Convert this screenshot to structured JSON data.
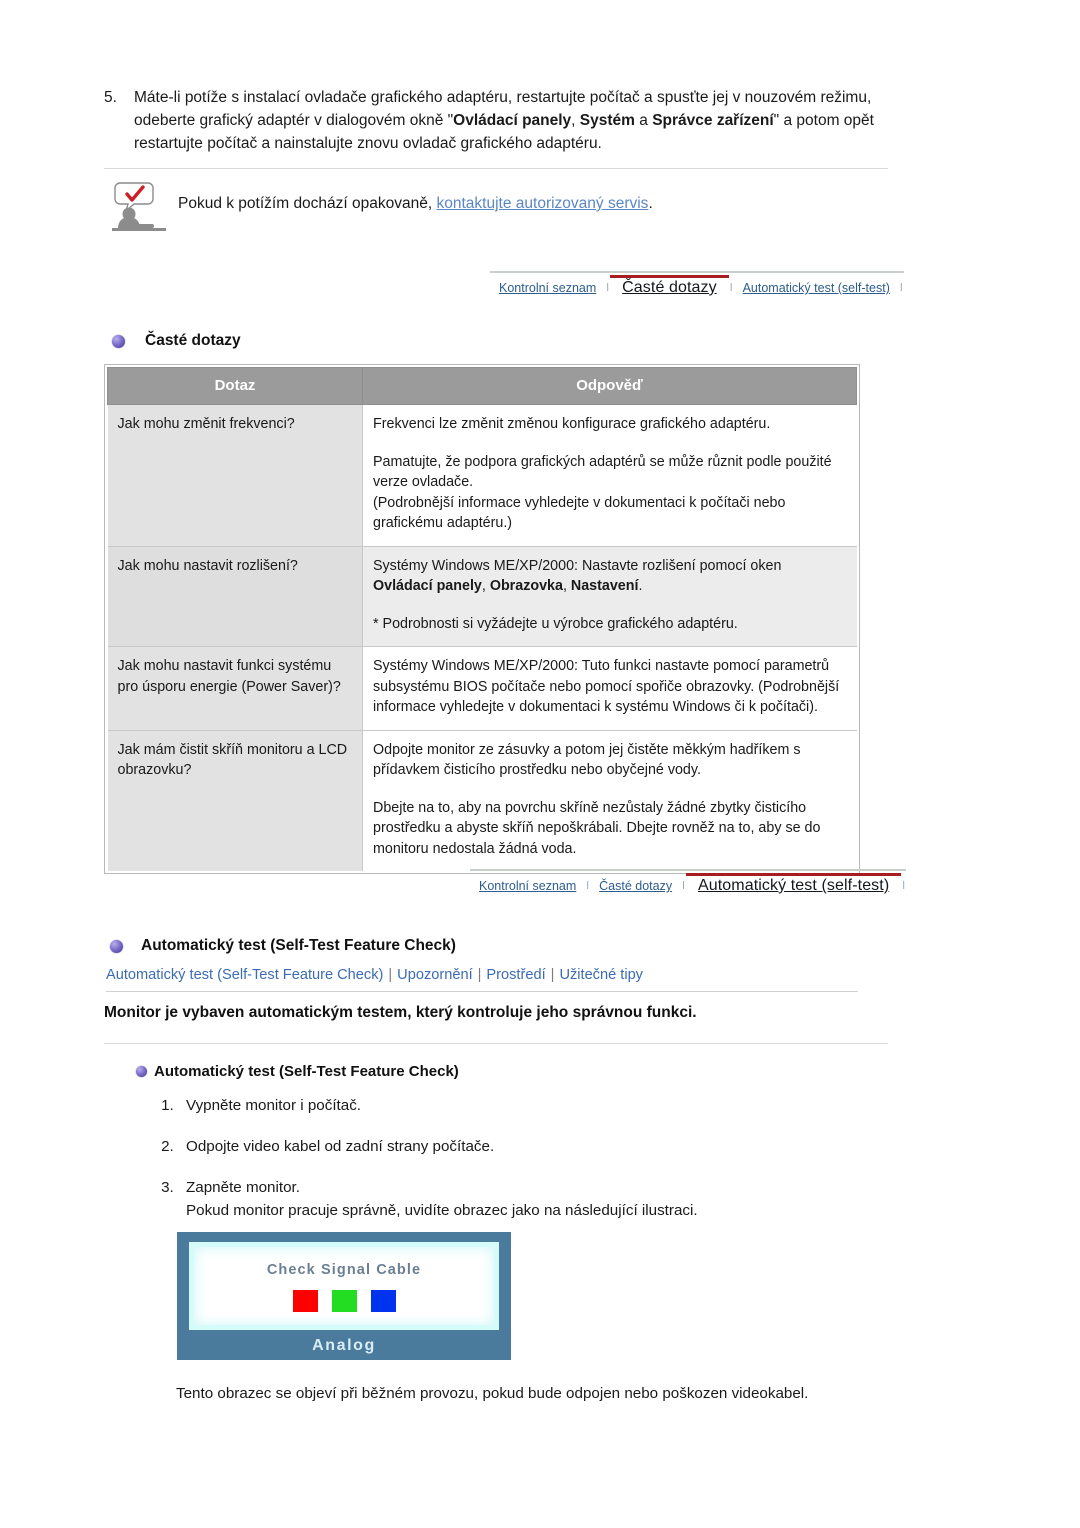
{
  "step5": {
    "number": "5.",
    "parts": [
      {
        "t": "Máte-li potíže s instalací ovladače grafického adaptéru, restartujte počítač a spusťte jej v nouzovém režimu, odeberte grafický adaptér v dialogovém okně \"",
        "b": false
      },
      {
        "t": "Ovládací panely",
        "b": true
      },
      {
        "t": ", ",
        "b": false
      },
      {
        "t": "Systém",
        "b": true
      },
      {
        "t": " a ",
        "b": false
      },
      {
        "t": "Správce zařízení",
        "b": true
      },
      {
        "t": "\" a potom opět restartujte počítač a nainstalujte znovu ovladač grafického adaptéru.",
        "b": false
      }
    ]
  },
  "tip": {
    "icon": "person-with-check-bubble-icon",
    "text_before": "Pokud k potížím dochází opakovaně, ",
    "link_text": "kontaktujte autorizovaný servis",
    "text_after": "."
  },
  "tabnav_1": {
    "tabs": [
      {
        "label": "Kontrolní seznam",
        "active": false
      },
      {
        "label": "Časté dotazy",
        "active": true
      },
      {
        "label": "Automatický test (self-test)",
        "active": false
      }
    ],
    "accent_color": "#a81d22",
    "link_color": "#2d5d8e"
  },
  "tabnav_2": {
    "tabs": [
      {
        "label": "Kontrolní seznam",
        "active": false
      },
      {
        "label": "Časté dotazy",
        "active": false
      },
      {
        "label": "Automatický test (self-test)",
        "active": true
      }
    ],
    "accent_color": "#a81d22",
    "link_color": "#2d5d8e"
  },
  "faq": {
    "heading": "Časté dotazy",
    "bullet_icon": "purple-ball-bullet-icon",
    "columns": [
      "Dotaz",
      "Odpověď"
    ],
    "header_bg": "#9b9b9b",
    "rows": [
      {
        "shade": false,
        "question": "Jak mohu změnit frekvenci?",
        "answer_blocks": [
          [
            {
              "t": "Frekvenci lze změnit změnou konfigurace grafického adaptéru.",
              "b": false
            }
          ],
          [
            {
              "t": "Pamatujte, že podpora grafických adaptérů se může různit podle použité verze ovladače.",
              "b": false
            }
          ],
          [
            {
              "t": "(Podrobnější informace vyhledejte v dokumentaci k počítači nebo grafickému adaptéru.)",
              "b": false
            }
          ]
        ],
        "tight_after": [
          1
        ]
      },
      {
        "shade": true,
        "question": "Jak mohu nastavit rozlišení?",
        "answer_blocks": [
          [
            {
              "t": "Systémy Windows ME/XP/2000: Nastavte rozlišení pomocí oken ",
              "b": false
            },
            {
              "t": "Ovládací panely",
              "b": true
            },
            {
              "t": ", ",
              "b": false
            },
            {
              "t": "Obrazovka",
              "b": true
            },
            {
              "t": ", ",
              "b": false
            },
            {
              "t": "Nastavení",
              "b": true
            },
            {
              "t": ".",
              "b": false
            }
          ],
          [
            {
              "t": "* Podrobnosti si vyžádejte u výrobce grafického adaptéru.",
              "b": false
            }
          ]
        ],
        "tight_after": []
      },
      {
        "shade": false,
        "question": "Jak mohu nastavit funkci systému pro úsporu energie (Power Saver)?",
        "answer_blocks": [
          [
            {
              "t": "Systémy Windows ME/XP/2000: Tuto funkci nastavte pomocí parametrů subsystému BIOS počítače nebo pomocí spořiče obrazovky. (Podrobnější informace vyhledejte v dokumentaci k systému Windows či k počítači).",
              "b": false
            }
          ]
        ],
        "tight_after": []
      },
      {
        "shade": false,
        "question": "Jak mám čistit skříň monitoru a LCD obrazovku?",
        "answer_blocks": [
          [
            {
              "t": "Odpojte monitor ze zásuvky a potom jej čistěte měkkým hadříkem s přídavkem čisticího prostředku nebo obyčejné vody.",
              "b": false
            }
          ],
          [
            {
              "t": "Dbejte na to, aby na povrchu skříně nezůstaly žádné zbytky čisticího prostředku a abyste skříň nepoškrábali. Dbejte rovněž na to, aby se do monitoru nedostala žádná voda.",
              "b": false
            }
          ]
        ],
        "tight_after": []
      }
    ]
  },
  "selftest": {
    "heading": "Automatický test (Self-Test Feature Check)",
    "bullet_icon": "purple-ball-bullet-icon",
    "subnav": [
      "Automatický test (Self-Test Feature Check)",
      "Upozornění",
      "Prostředí",
      "Užitečné tipy"
    ],
    "subnav_color": "#3b6bb5",
    "bold_note": "Monitor je vybaven automatickým testem, který kontroluje jeho správnou funkci.",
    "sub_heading": "Automatický test (Self-Test Feature Check)",
    "steps": [
      "Vypněte monitor i počítač.",
      "Odpojte video kabel od zadní strany počítače.",
      "Zapněte monitor.\nPokud monitor pracuje správně, uvidíte obrazec jako na následující ilustraci."
    ],
    "closing": "Tento obrazec se objeví při běžném provozu, pokud bude odpojen nebo poškozen videokabel."
  },
  "monitor_graphic": {
    "message": "Check Signal Cable",
    "footer_label": "Analog",
    "bezel_color": "#4b7b9c",
    "screen_color": "#ffffff",
    "glow_color": "#d6fbfb",
    "message_color": "#6b7f94",
    "swatches": [
      {
        "name": "red-swatch",
        "color": "#ff0000"
      },
      {
        "name": "green-swatch",
        "color": "#22dd22"
      },
      {
        "name": "blue-swatch",
        "color": "#0033ee"
      }
    ]
  }
}
